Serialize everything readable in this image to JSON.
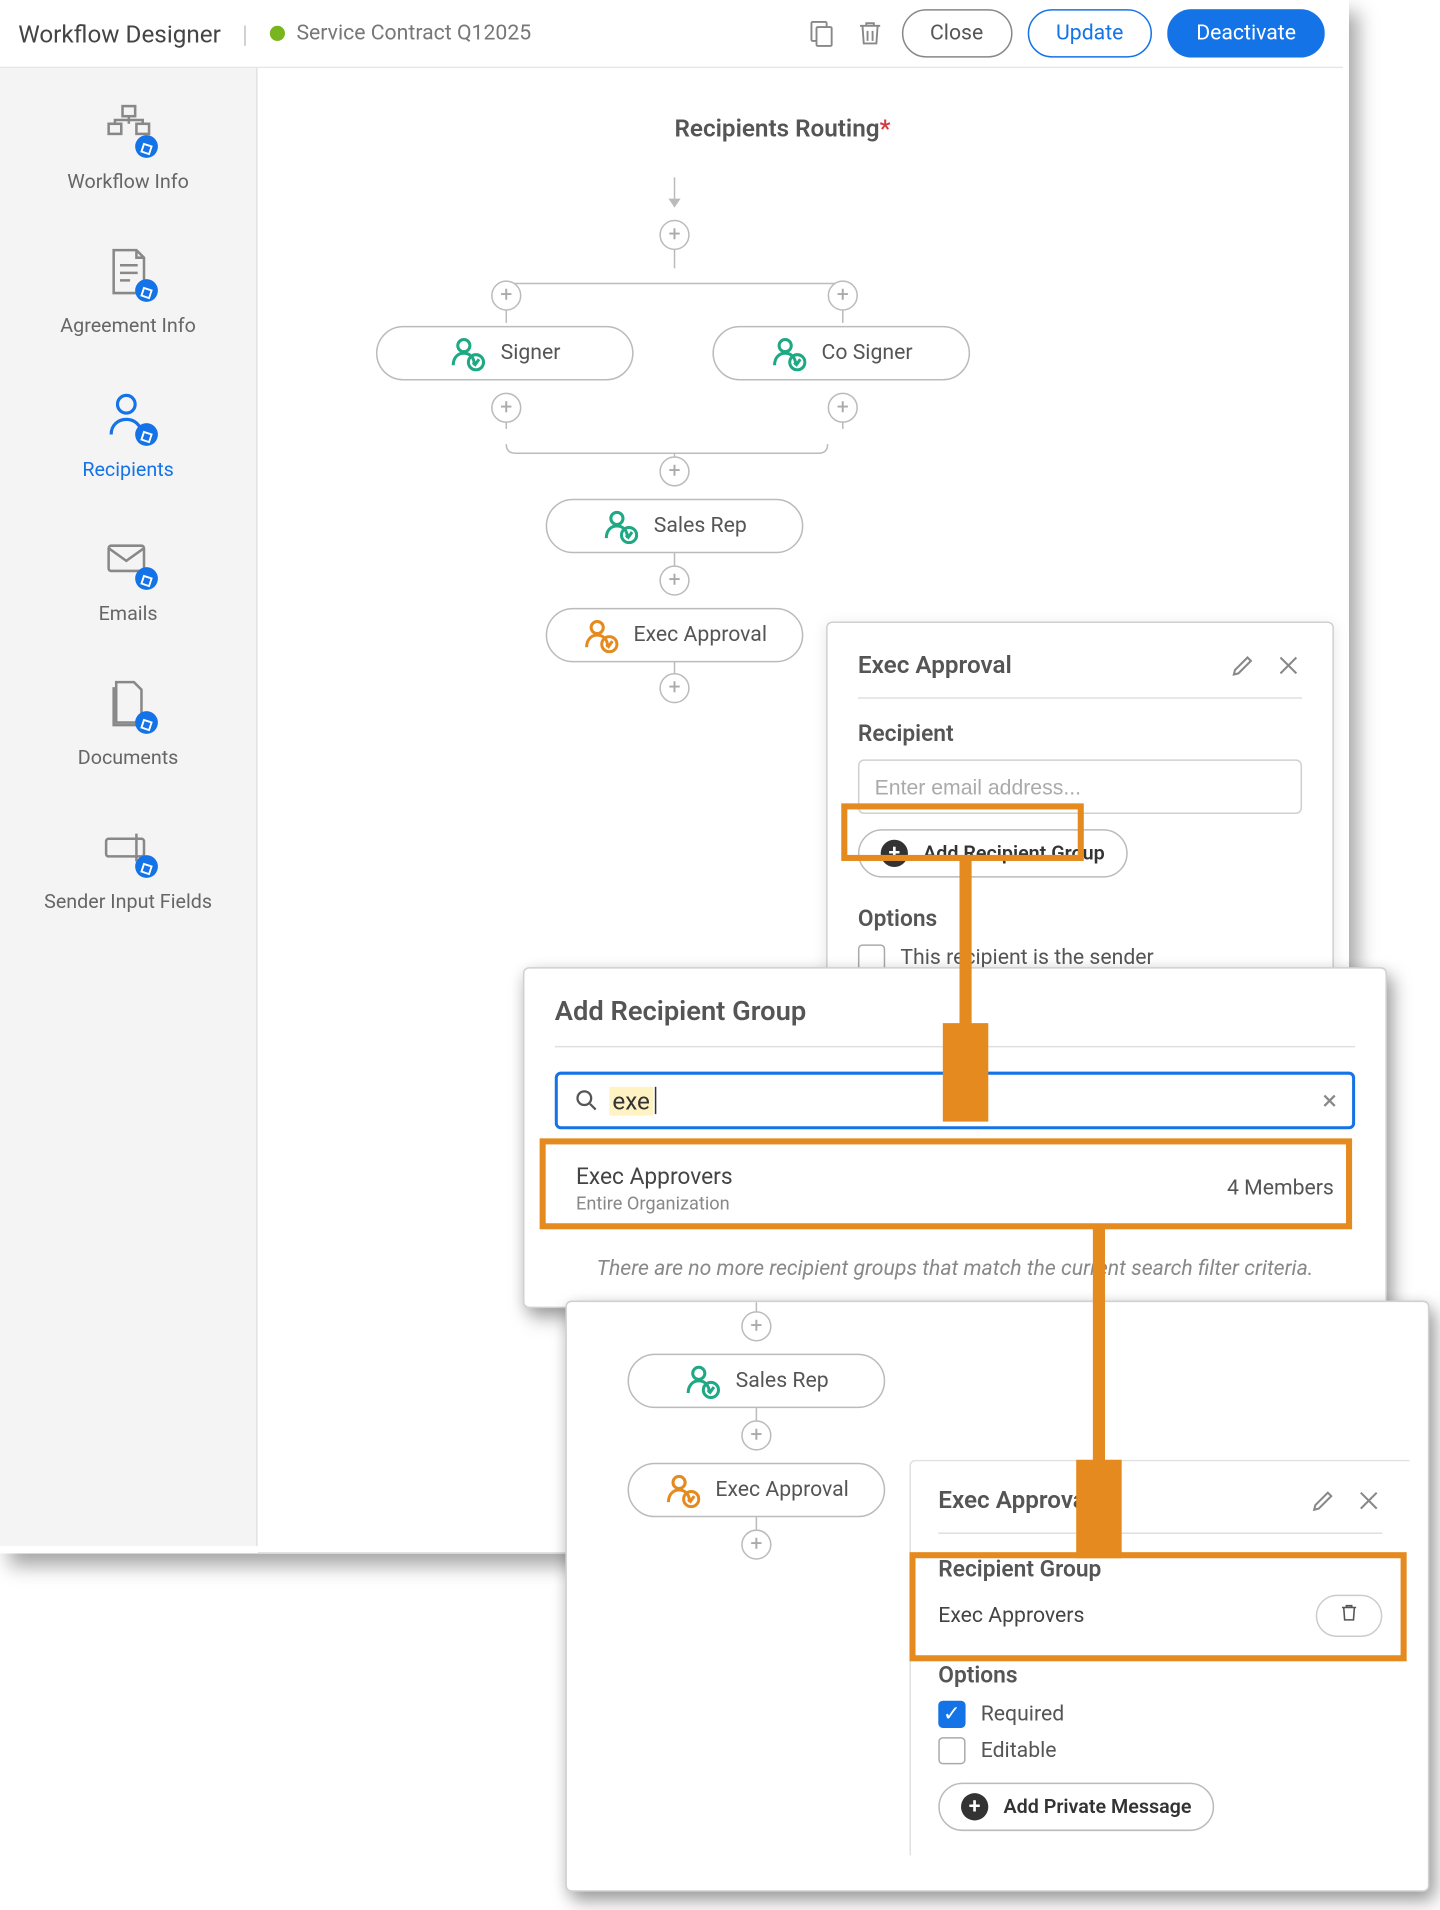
{
  "topbar": {
    "app_title": "Workflow Designer",
    "doc_title": "Service Contract Q12025",
    "close": "Close",
    "update": "Update",
    "deactivate": "Deactivate"
  },
  "sidebar": {
    "items": [
      {
        "label": "Workflow Info"
      },
      {
        "label": "Agreement Info"
      },
      {
        "label": "Recipients"
      },
      {
        "label": "Emails"
      },
      {
        "label": "Documents"
      },
      {
        "label": "Sender Input Fields"
      }
    ]
  },
  "routing": {
    "title": "Recipients Routing",
    "nodes": {
      "signer": "Signer",
      "cosigner": "Co Signer",
      "salesrep": "Sales Rep",
      "execapproval": "Exec Approval"
    }
  },
  "panel1": {
    "title": "Exec Approval",
    "recipient_label": "Recipient",
    "email_placeholder": "Enter email address...",
    "add_group_btn": "Add Recipient Group",
    "options_label": "Options",
    "sender_checkbox": "This recipient is the sender"
  },
  "modal": {
    "title": "Add Recipient Group",
    "search_value": "exe",
    "result_name": "Exec Approvers",
    "result_sub": "Entire Organization",
    "result_members": "4 Members",
    "empty_msg": "There are no more recipient groups that match the current search filter criteria."
  },
  "panel2": {
    "title": "Exec Approval",
    "group_label": "Recipient Group",
    "group_name": "Exec Approvers",
    "options_label": "Options",
    "required": "Required",
    "editable": "Editable",
    "add_private": "Add Private Message",
    "salesrep": "Sales Rep",
    "execapproval": "Exec Approval"
  }
}
